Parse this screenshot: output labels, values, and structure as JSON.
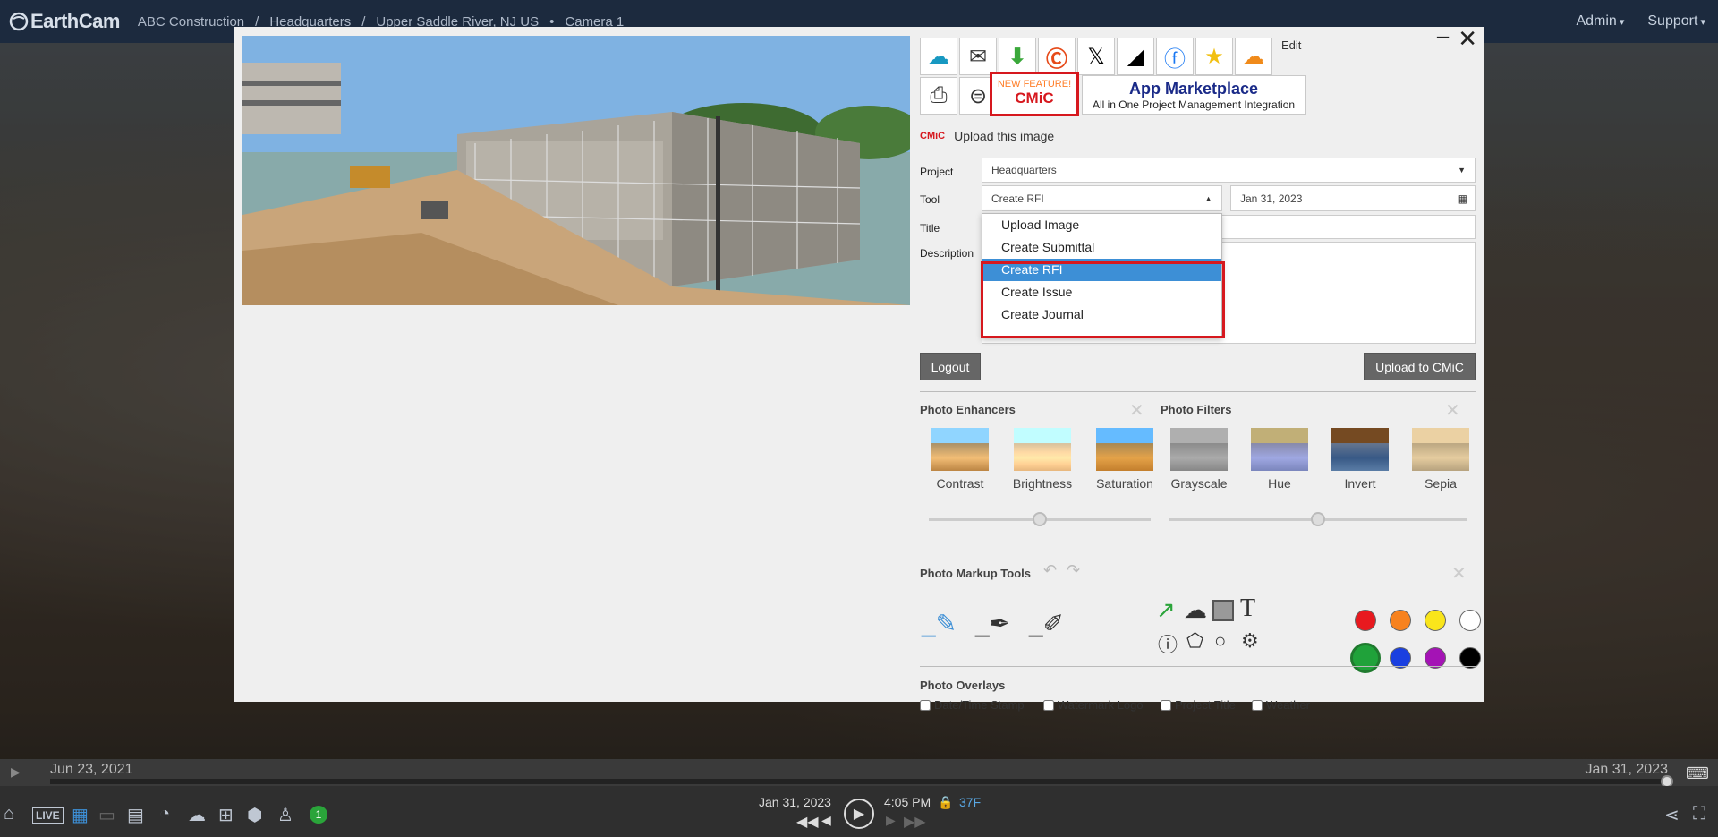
{
  "app": {
    "brand": "EarthCam"
  },
  "breadcrumb": [
    "ABC Construction",
    "/",
    "Headquarters",
    "/",
    "Upper Saddle River, NJ US",
    "•",
    "Camera 1"
  ],
  "topnav": {
    "admin": "Admin",
    "support": "Support"
  },
  "modal": {
    "edit_label": "Edit",
    "new_feature": "NEW FEATURE!",
    "cmic_logo": "CMiC",
    "app_marketplace_title": "App Marketplace",
    "app_marketplace_sub": "All in One Project Management Integration",
    "upload_heading": "Upload this image",
    "upload_heading_logo": "CMiC",
    "form": {
      "project_label": "Project",
      "project_value": "Headquarters",
      "tool_label": "Tool",
      "tool_value": "Create RFI",
      "date_value": "Jan 31, 2023",
      "title_label": "Title",
      "description_label": "Description"
    },
    "tool_options": [
      "Upload Image",
      "Create Submittal",
      "Create RFI",
      "Create Issue",
      "Create Journal"
    ],
    "tool_selected_index": 2,
    "logout_label": "Logout",
    "upload_button_label": "Upload to CMiC",
    "enhancers": {
      "title": "Photo Enhancers",
      "items": [
        "Contrast",
        "Brightness",
        "Saturation"
      ],
      "level": 0.5
    },
    "filters": {
      "title": "Photo Filters",
      "items": [
        "Grayscale",
        "Hue",
        "Invert",
        "Sepia"
      ],
      "level": 0.5
    },
    "markup": {
      "title": "Photo Markup Tools",
      "colors": [
        "#e8191f",
        "#f7821e",
        "#f9e51b",
        "#ffffff",
        "#20a23a",
        "#1a3fe0",
        "#a413b5",
        "#000000"
      ],
      "selected_color": "#20a23a"
    },
    "overlays": {
      "title": "Photo Overlays",
      "items": [
        "Date/Time Stamp",
        "Watermark Logo",
        "Project Title",
        "Weather"
      ]
    }
  },
  "timeline": {
    "start": "Jun 23, 2021",
    "end": "Jan 31, 2023"
  },
  "player": {
    "date": "Jan 31, 2023",
    "time": "4:05 PM",
    "temp": "37F",
    "live_label": "LIVE",
    "badge": "1"
  }
}
